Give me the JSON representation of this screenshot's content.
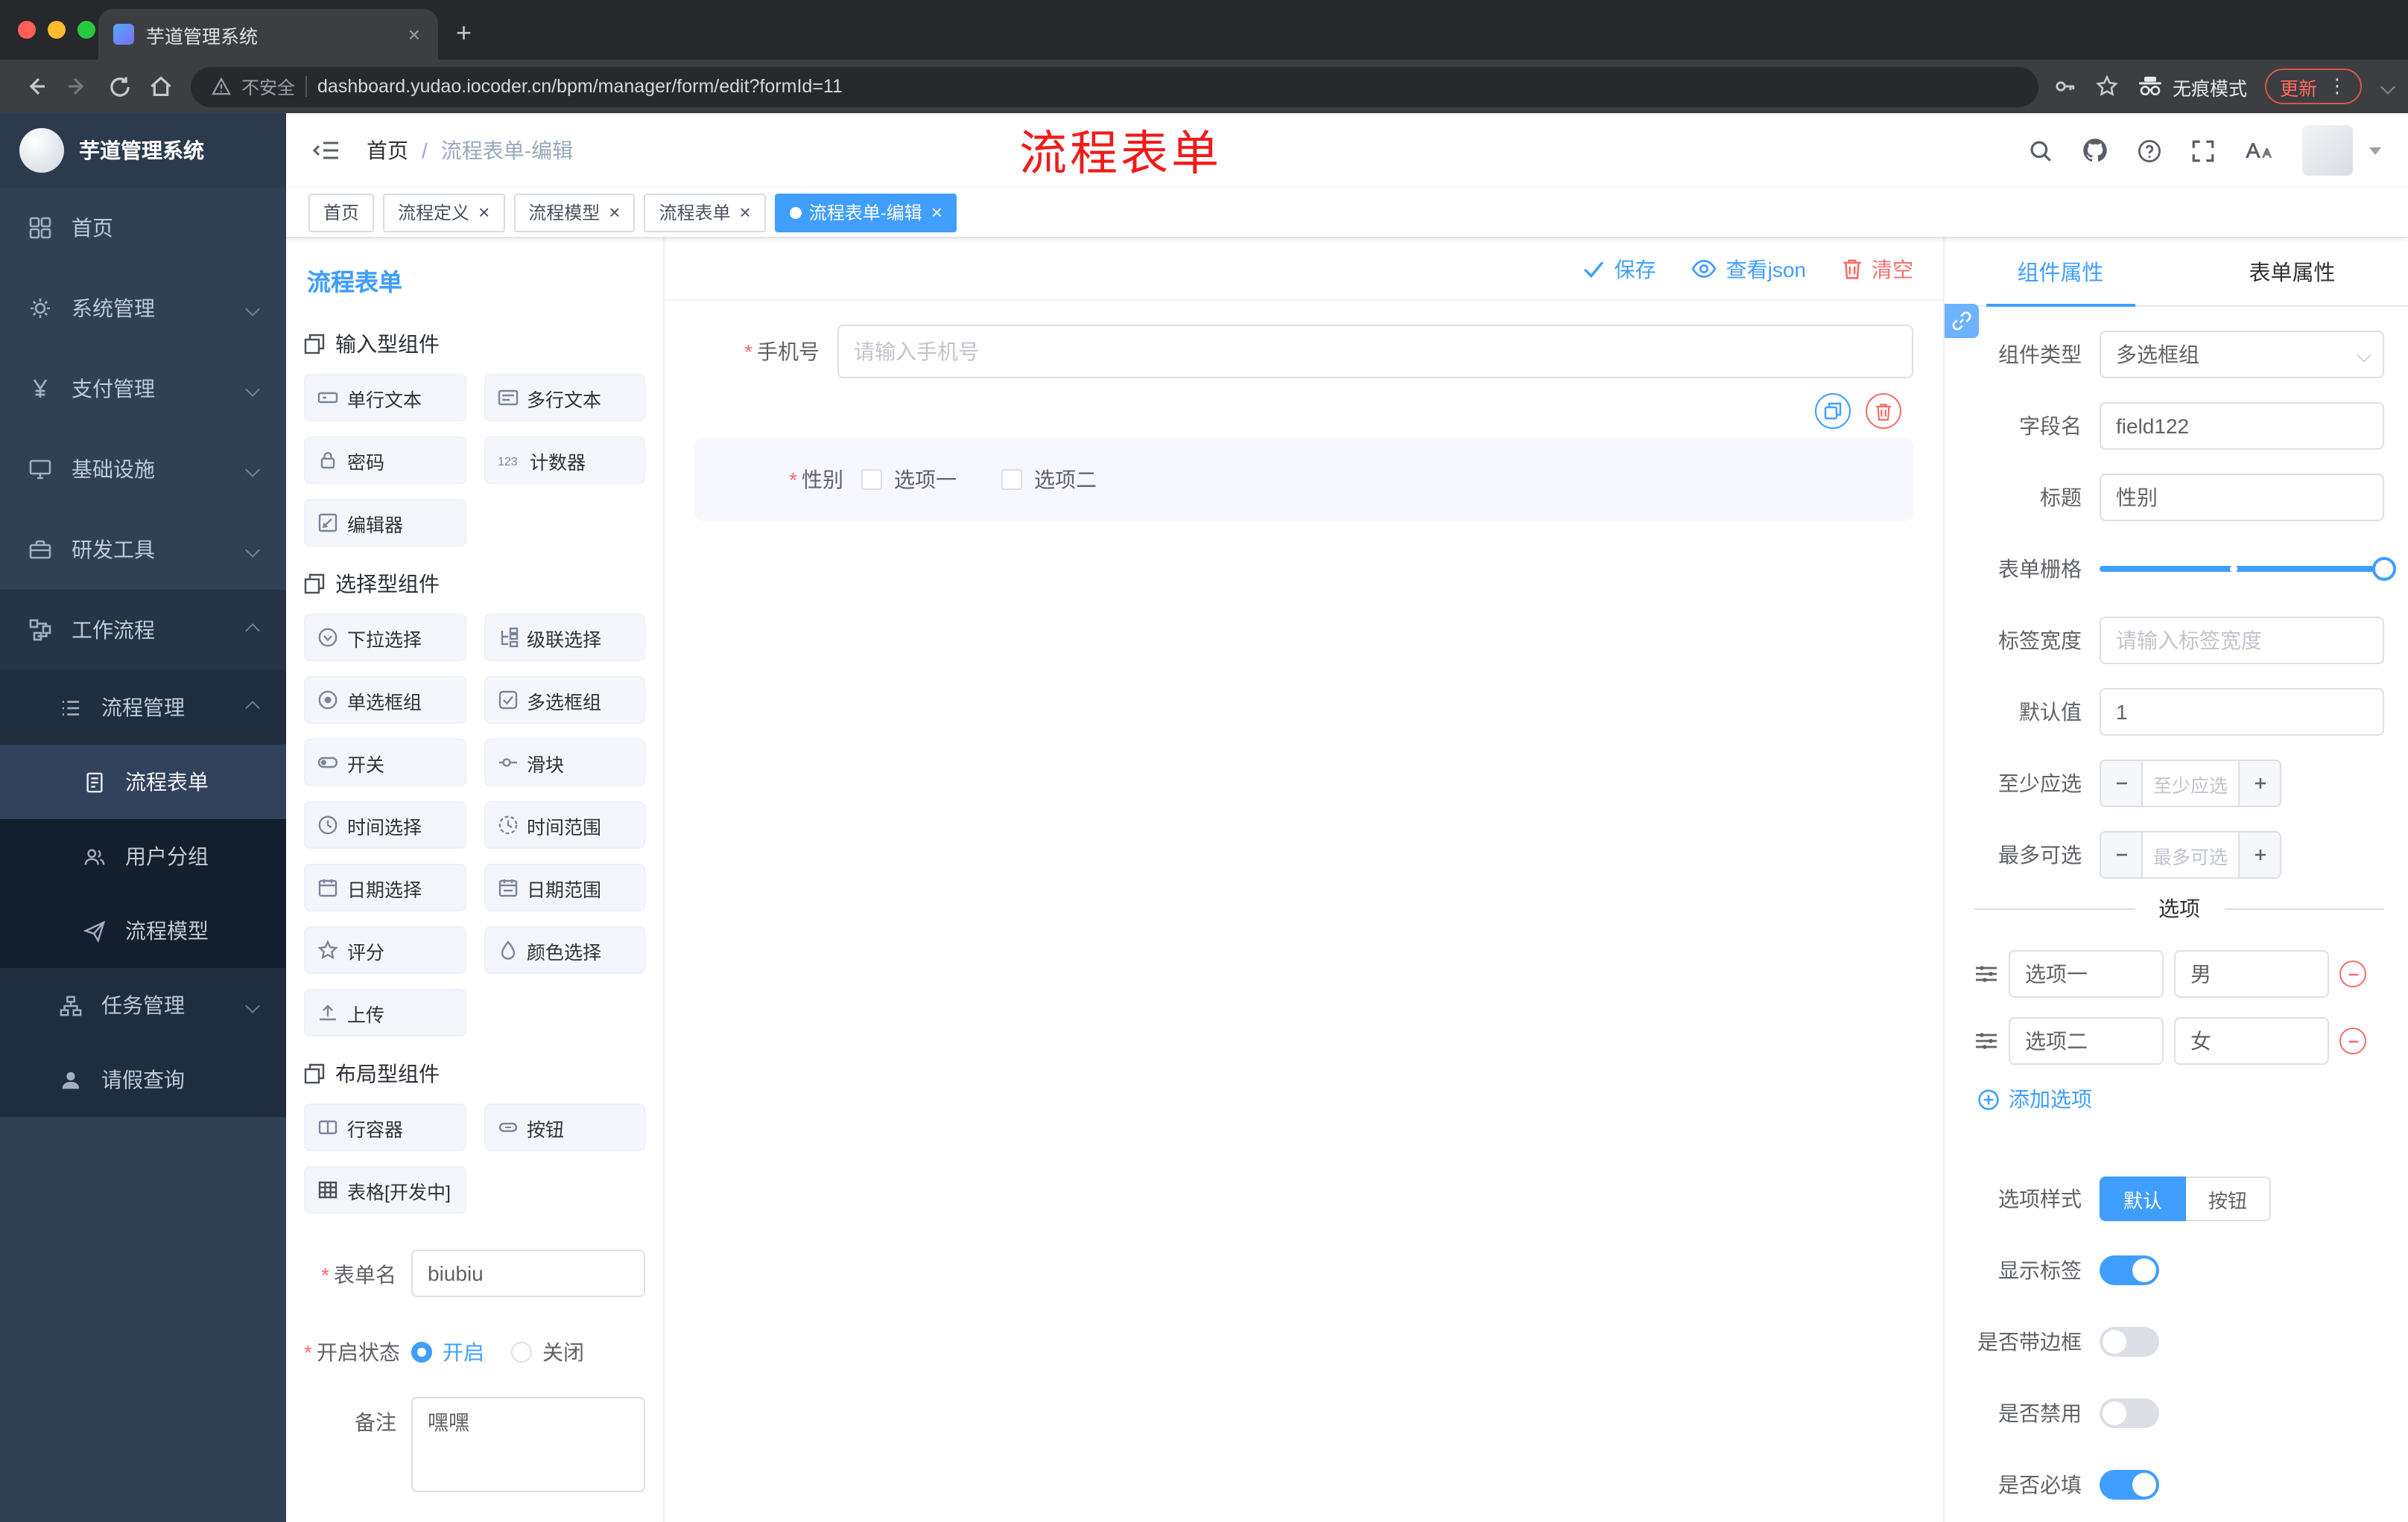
{
  "ui": {
    "close_glyph": "×",
    "new_tab_glyph": "+",
    "menu_dots": "⋮",
    "required_mark": "*",
    "breadcrumb_separator": "/",
    "counter_icon_text": "123"
  },
  "browser": {
    "tab_title": "芋道管理系统",
    "security_label": "不安全",
    "url": "dashboard.yudao.iocoder.cn/bpm/manager/form/edit?formId=11",
    "incognito_label": "无痕模式",
    "update_label": "更新"
  },
  "sidebar": {
    "logo_title": "芋道管理系统",
    "items": [
      "首页",
      "系统管理",
      "支付管理",
      "基础设施",
      "研发工具",
      "工作流程"
    ],
    "workflow": {
      "process_management": "流程管理",
      "process_children": [
        "流程表单",
        "用户分组",
        "流程模型"
      ],
      "task_management": "任务管理",
      "leave_query": "请假查询"
    },
    "active_item": "流程表单"
  },
  "header": {
    "breadcrumb_home": "首页",
    "breadcrumb_current": "流程表单-编辑",
    "annotation": "流程表单"
  },
  "tags": {
    "items": [
      "首页",
      "流程定义",
      "流程模型",
      "流程表单",
      "流程表单-编辑"
    ],
    "active": "流程表单-编辑"
  },
  "palette": {
    "panel_title": "流程表单",
    "sections": [
      {
        "title": "输入型组件",
        "items": [
          "单行文本",
          "多行文本",
          "密码",
          "计数器",
          "编辑器"
        ]
      },
      {
        "title": "选择型组件",
        "items": [
          "下拉选择",
          "级联选择",
          "单选框组",
          "多选框组",
          "开关",
          "滑块",
          "时间选择",
          "时间范围",
          "日期选择",
          "日期范围",
          "评分",
          "颜色选择",
          "上传"
        ]
      },
      {
        "title": "布局型组件",
        "items": [
          "行容器",
          "按钮",
          "表格[开发中]"
        ]
      }
    ],
    "form": {
      "name_label": "表单名",
      "name_value": "biubiu",
      "status_label": "开启状态",
      "status_on": "开启",
      "status_off": "关闭",
      "status_selected": "开启",
      "remark_label": "备注",
      "remark_value": "嘿嘿"
    }
  },
  "canvas": {
    "toolbar": {
      "save": "保存",
      "view_json": "查看json",
      "clear": "清空"
    },
    "phone": {
      "label": "手机号",
      "placeholder": "请输入手机号",
      "required": true
    },
    "gender": {
      "label": "性别",
      "options": [
        "选项一",
        "选项二"
      ],
      "required": true,
      "selected": true
    }
  },
  "props": {
    "tab_component": "组件属性",
    "tab_form": "表单属性",
    "active_tab": "组件属性",
    "component_type_label": "组件类型",
    "component_type_value": "多选框组",
    "field_name_label": "字段名",
    "field_name_value": "field122",
    "title_label": "标题",
    "title_value": "性别",
    "grid_label": "表单栅格",
    "label_width_label": "标签宽度",
    "label_width_placeholder": "请输入标签宽度",
    "default_label": "默认值",
    "default_value": "1",
    "min_label": "至少应选",
    "min_placeholder": "至少应选",
    "max_label": "最多可选",
    "max_placeholder": "最多可选",
    "options_title": "选项",
    "options": [
      {
        "label": "选项一",
        "value": "男"
      },
      {
        "label": "选项二",
        "value": "女"
      }
    ],
    "add_option": "添加选项",
    "option_style_label": "选项样式",
    "option_style_default": "默认",
    "option_style_button": "按钮",
    "option_style_selected": "默认",
    "show_label": "显示标签",
    "bordered_label": "是否带边框",
    "disabled_label": "是否禁用",
    "required_label": "是否必填",
    "switch_states": {
      "show_label": true,
      "bordered": false,
      "disabled": false,
      "required": true
    }
  },
  "colors": {
    "accent": "#409EFF",
    "danger": "#F56C6C",
    "annotation_red": "#F11B1B",
    "sidebar_bg": "#304156",
    "sidebar_submenu_bg": "#1F2D3D",
    "sidebar_active_bg": "#31425C",
    "mac_red": "#FF5F57",
    "mac_yellow": "#FEBC2E",
    "mac_green": "#28C840"
  }
}
